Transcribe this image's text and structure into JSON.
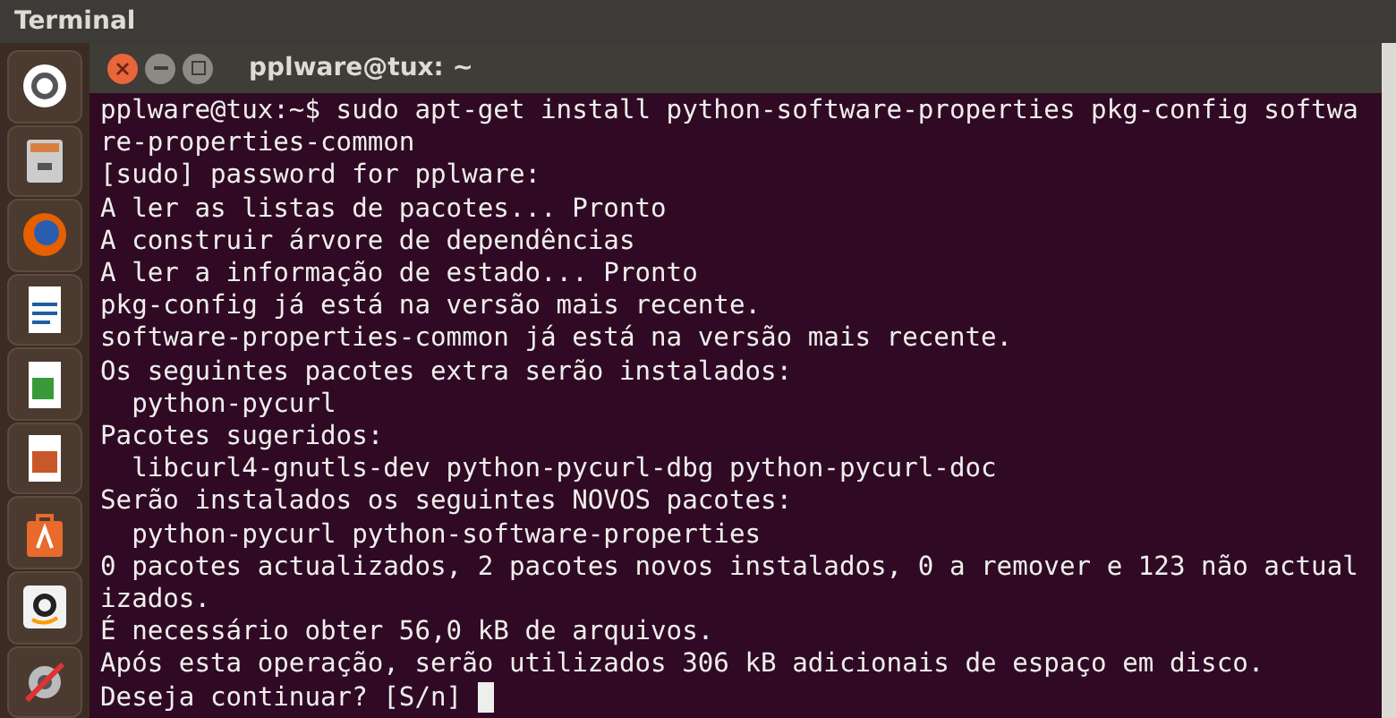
{
  "top_panel": {
    "title": "Terminal"
  },
  "window": {
    "title": "pplware@tux: ~"
  },
  "terminal": {
    "lines": [
      "pplware@tux:~$ sudo apt-get install python-software-properties pkg-config softwa",
      "re-properties-common",
      "[sudo] password for pplware:",
      "A ler as listas de pacotes... Pronto",
      "A construir árvore de dependências",
      "A ler a informação de estado... Pronto",
      "pkg-config já está na versão mais recente.",
      "software-properties-common já está na versão mais recente.",
      "Os seguintes pacotes extra serão instalados:",
      "  python-pycurl",
      "Pacotes sugeridos:",
      "  libcurl4-gnutls-dev python-pycurl-dbg python-pycurl-doc",
      "Serão instalados os seguintes NOVOS pacotes:",
      "  python-pycurl python-software-properties",
      "0 pacotes actualizados, 2 pacotes novos instalados, 0 a remover e 123 não actual",
      "izados.",
      "É necessário obter 56,0 kB de arquivos.",
      "Após esta operação, serão utilizados 306 kB adicionais de espaço em disco.",
      "Deseja continuar? [S/n] "
    ]
  }
}
